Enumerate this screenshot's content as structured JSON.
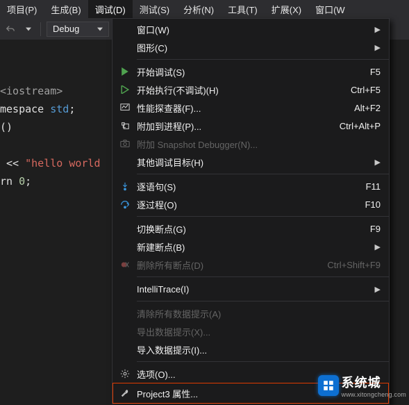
{
  "menubar": {
    "items": [
      {
        "label": "项目(P)"
      },
      {
        "label": "生成(B)"
      },
      {
        "label": "调试(D)"
      },
      {
        "label": "测试(S)"
      },
      {
        "label": "分析(N)"
      },
      {
        "label": "工具(T)"
      },
      {
        "label": "扩展(X)"
      },
      {
        "label": "窗口(W"
      }
    ],
    "active_index": 2
  },
  "toolbar": {
    "config_value": "Debug"
  },
  "editor": {
    "lines": [
      "<iostream>",
      "mespace std;",
      "()",
      "",
      " << \"hello world",
      "rn 0;"
    ]
  },
  "dropdown": {
    "groups": [
      [
        {
          "label": "窗口(W)",
          "submenu": true
        },
        {
          "label": "图形(C)",
          "submenu": true
        }
      ],
      [
        {
          "icon": "play-green",
          "label": "开始调试(S)",
          "shortcut": "F5"
        },
        {
          "icon": "play-outline",
          "label": "开始执行(不调试)(H)",
          "shortcut": "Ctrl+F5"
        },
        {
          "icon": "profiler",
          "label": "性能探查器(F)...",
          "shortcut": "Alt+F2"
        },
        {
          "icon": "attach",
          "label": "附加到进程(P)...",
          "shortcut": "Ctrl+Alt+P"
        },
        {
          "icon": "camera",
          "label": "附加 Snapshot Debugger(N)...",
          "disabled": true
        },
        {
          "label": "其他调试目标(H)",
          "submenu": true
        }
      ],
      [
        {
          "icon": "step-into",
          "label": "逐语句(S)",
          "shortcut": "F11"
        },
        {
          "icon": "step-over",
          "label": "逐过程(O)",
          "shortcut": "F10"
        }
      ],
      [
        {
          "label": "切换断点(G)",
          "shortcut": "F9"
        },
        {
          "label": "新建断点(B)",
          "submenu": true
        },
        {
          "icon": "delete-bp",
          "label": "删除所有断点(D)",
          "shortcut": "Ctrl+Shift+F9",
          "disabled": true
        }
      ],
      [
        {
          "label": "IntelliTrace(I)",
          "submenu": true
        }
      ],
      [
        {
          "label": "清除所有数据提示(A)",
          "disabled": true
        },
        {
          "label": "导出数据提示(X)...",
          "disabled": true
        },
        {
          "label": "导入数据提示(I)..."
        }
      ],
      [
        {
          "icon": "gear",
          "label": "选项(O)..."
        },
        {
          "icon": "wrench",
          "label": "Project3 属性...",
          "highlight": true
        }
      ]
    ]
  },
  "watermark": {
    "brand": "系统城",
    "url": "www.xitongcheng.com"
  }
}
